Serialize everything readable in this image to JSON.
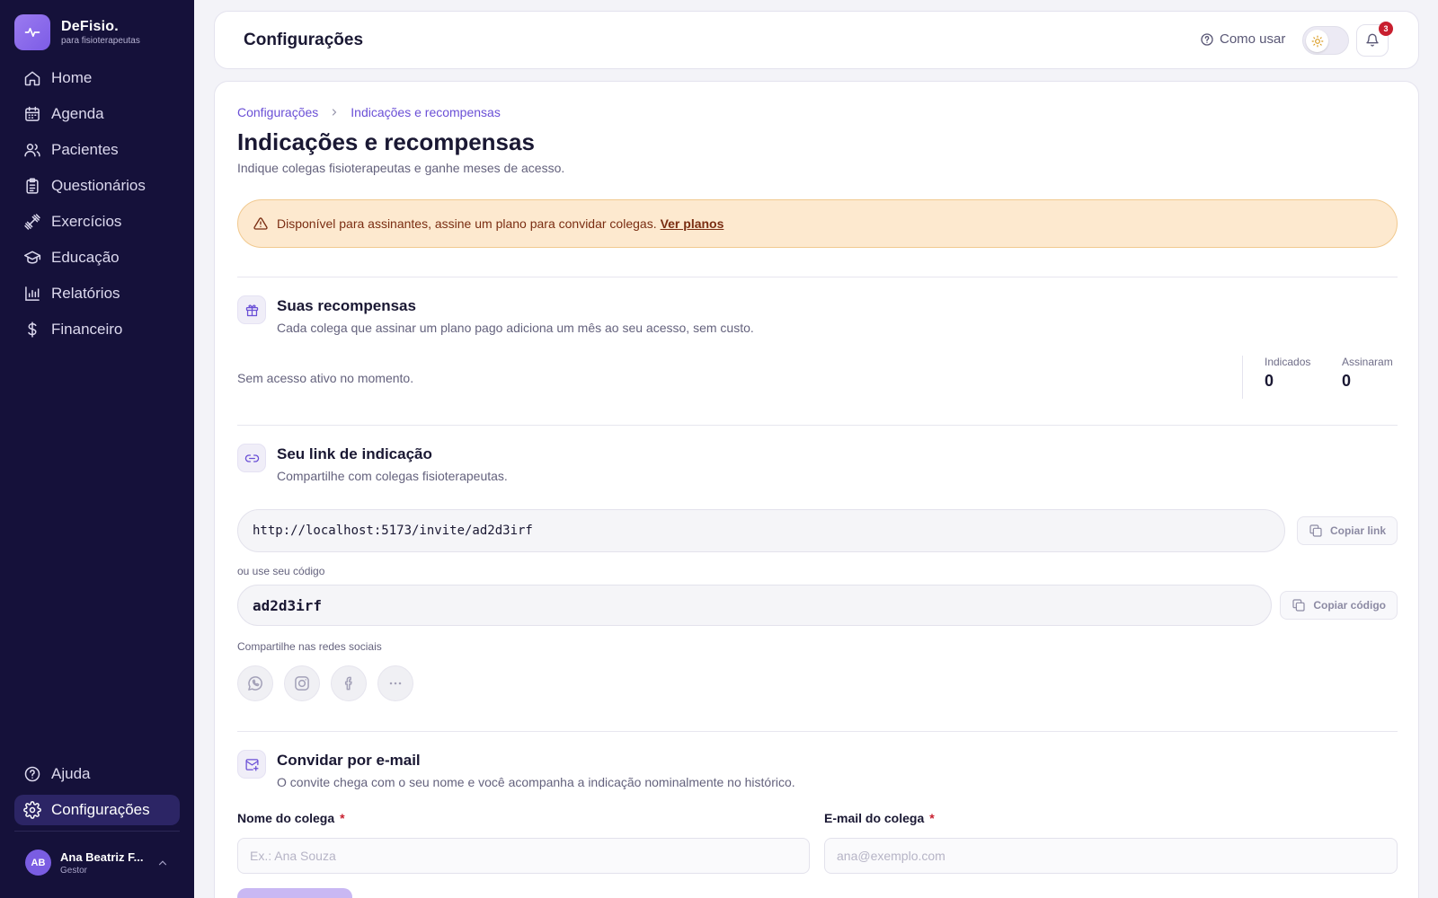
{
  "brand": {
    "name": "DeFisio.",
    "tagline": "para fisioterapeutas"
  },
  "nav": {
    "items": [
      {
        "label": "Home",
        "icon": "home-icon"
      },
      {
        "label": "Agenda",
        "icon": "calendar-icon"
      },
      {
        "label": "Pacientes",
        "icon": "users-icon"
      },
      {
        "label": "Questionários",
        "icon": "clipboard-icon"
      },
      {
        "label": "Exercícios",
        "icon": "dumbbell-icon"
      },
      {
        "label": "Educação",
        "icon": "graduation-cap-icon"
      },
      {
        "label": "Relatórios",
        "icon": "bar-chart-icon"
      },
      {
        "label": "Financeiro",
        "icon": "dollar-icon"
      }
    ],
    "bottom": [
      {
        "label": "Ajuda",
        "icon": "help-circle-icon"
      },
      {
        "label": "Configurações",
        "icon": "gear-icon",
        "active": true
      }
    ]
  },
  "user": {
    "initials": "AB",
    "name": "Ana Beatriz F...",
    "role": "Gestor"
  },
  "header": {
    "title": "Configurações",
    "help_label": "Como usar",
    "notification_count": "3"
  },
  "breadcrumb": {
    "root": "Configurações",
    "current": "Indicações e recompensas"
  },
  "page": {
    "title": "Indicações e recompensas",
    "subtitle": "Indique colegas fisioterapeutas e ganhe meses de acesso."
  },
  "alert": {
    "text": "Disponível para assinantes, assine um plano para convidar colegas.",
    "link": "Ver planos"
  },
  "rewards": {
    "title": "Suas recompensas",
    "description": "Cada colega que assinar um plano pago adiciona um mês ao seu acesso, sem custo.",
    "status": "Sem acesso ativo no momento.",
    "stats": [
      {
        "label": "Indicados",
        "value": "0"
      },
      {
        "label": "Assinaram",
        "value": "0"
      }
    ]
  },
  "referral": {
    "title": "Seu link de indicação",
    "description": "Compartilhe com colegas fisioterapeutas.",
    "link": "http://localhost:5173/invite/ad2d3irf",
    "copy_link_label": "Copiar link",
    "code_label": "ou use seu código",
    "code": "ad2d3irf",
    "copy_code_label": "Copiar código",
    "social_label": "Compartilhe nas redes sociais"
  },
  "invite": {
    "title": "Convidar por e-mail",
    "description": "O convite chega com o seu nome e você acompanha a indicação nominalmente no histórico.",
    "name_label": "Nome do colega",
    "name_placeholder": "Ex.: Ana Souza",
    "email_label": "E-mail do colega",
    "email_placeholder": "ana@exemplo.com",
    "required_mark": "*"
  },
  "colors": {
    "sidebar": "#15113a",
    "accent": "#6a4fd6",
    "alert_bg": "#fde9cf",
    "alert_text": "#7a2d12",
    "badge": "#c81f2f"
  }
}
